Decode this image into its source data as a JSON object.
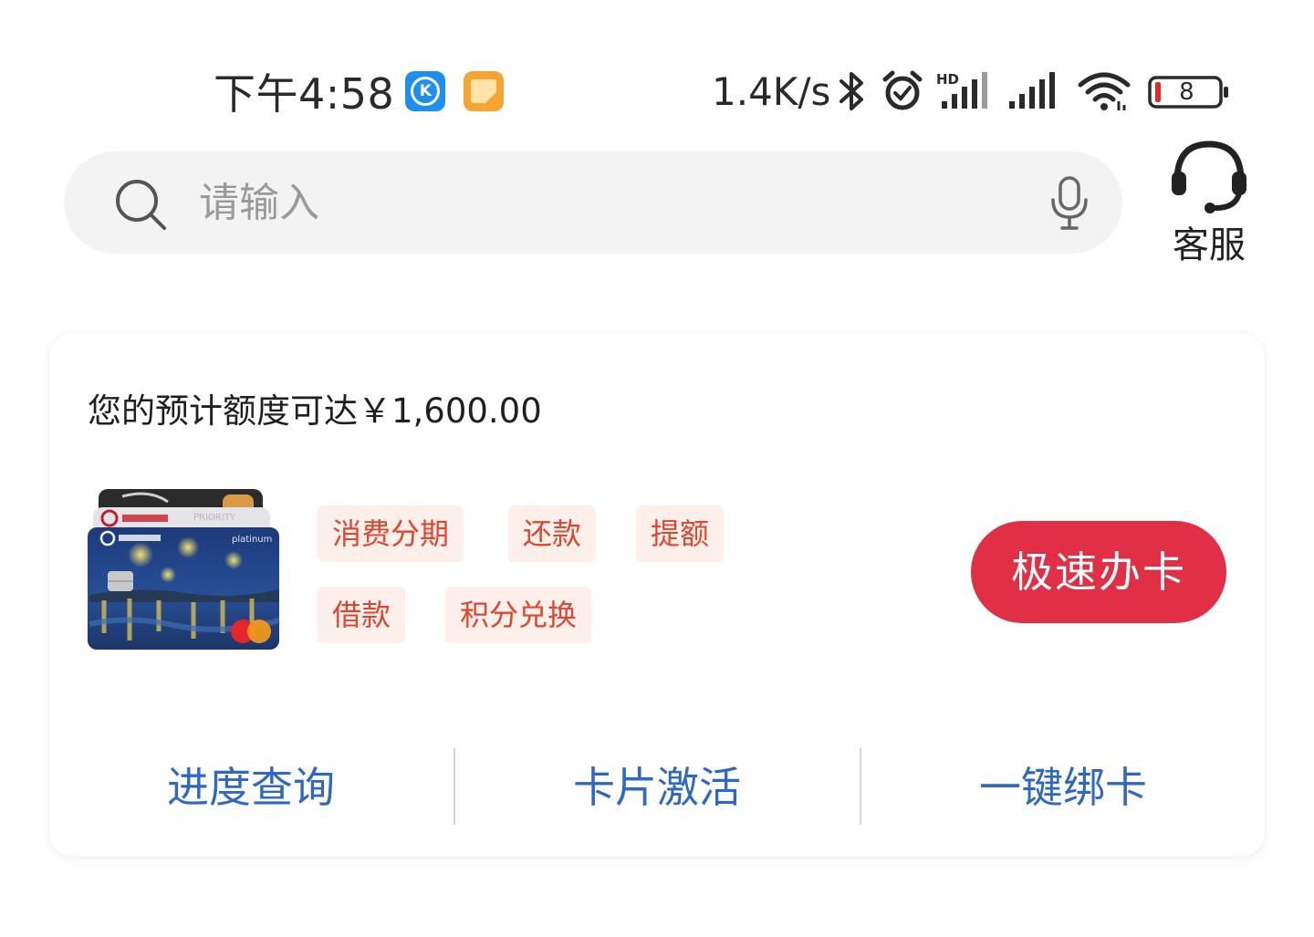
{
  "status_bar": {
    "time": "下午4:58",
    "network_speed": "1.4K/s",
    "battery_level": "8",
    "icons": [
      "k-app-icon",
      "note-app-icon",
      "bluetooth-icon",
      "alarm-icon",
      "hd-signal-icon",
      "signal-icon",
      "wifi-icon",
      "battery-icon"
    ]
  },
  "search": {
    "placeholder": "请输入"
  },
  "service": {
    "label": "客服",
    "icon": "headset-icon"
  },
  "credit_card": {
    "estimate_text": "您的预计额度可达￥1,600.00",
    "tags": [
      "消费分期",
      "还款",
      "提额",
      "借款",
      "积分兑换"
    ],
    "apply_label": "极速办卡",
    "quick_links": [
      "进度查询",
      "卡片激活",
      "一键绑卡"
    ]
  },
  "colors": {
    "accent_red": "#e12f45",
    "tag_text": "#e0462f",
    "tag_bg": "#fdf0ea",
    "link_blue": "#2f68c4"
  }
}
